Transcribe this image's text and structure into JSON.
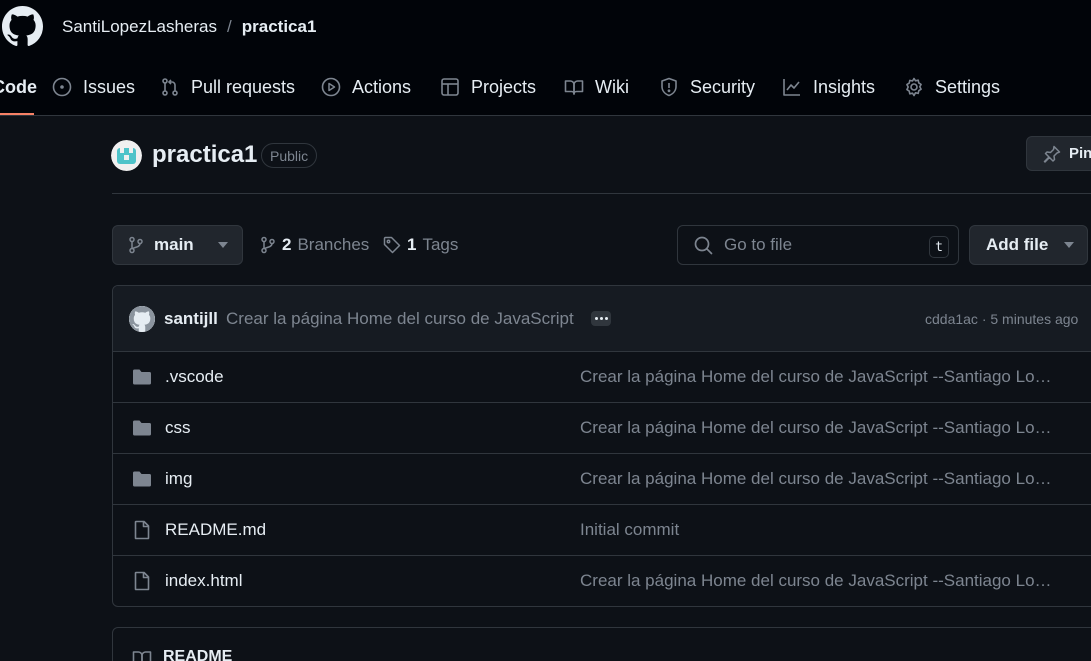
{
  "header": {
    "owner": "SantiLopezLasheras",
    "separator": "/",
    "repo": "practica1"
  },
  "tabs": [
    {
      "label": "Code",
      "icon": "code-icon"
    },
    {
      "label": "Issues",
      "icon": "issue-opened-icon"
    },
    {
      "label": "Pull requests",
      "icon": "git-pull-request-icon"
    },
    {
      "label": "Actions",
      "icon": "play-icon"
    },
    {
      "label": "Projects",
      "icon": "table-icon"
    },
    {
      "label": "Wiki",
      "icon": "book-icon"
    },
    {
      "label": "Security",
      "icon": "shield-icon"
    },
    {
      "label": "Insights",
      "icon": "graph-icon"
    },
    {
      "label": "Settings",
      "icon": "gear-icon"
    }
  ],
  "repo": {
    "name": "practica1",
    "visibility": "Public",
    "pin_label": "Pin"
  },
  "controls": {
    "branch": "main",
    "branches_count": "2",
    "branches_label": "Branches",
    "tags_count": "1",
    "tags_label": "Tags",
    "goto_placeholder": "Go to file",
    "goto_shortcut": "t",
    "add_file_label": "Add file"
  },
  "latest_commit": {
    "author": "santijll",
    "message": "Crear la página Home del curso de JavaScript",
    "meta": "cdda1ac · 5 minutes ago"
  },
  "files": [
    {
      "name": ".vscode",
      "type": "folder",
      "commit": "Crear la página Home del curso de JavaScript --Santiago Lopez Lasheras"
    },
    {
      "name": "css",
      "type": "folder",
      "commit": "Crear la página Home del curso de JavaScript --Santiago Lopez Lasheras"
    },
    {
      "name": "img",
      "type": "folder",
      "commit": "Crear la página Home del curso de JavaScript --Santiago Lopez Lasheras"
    },
    {
      "name": "README.md",
      "type": "file",
      "commit": "Initial commit"
    },
    {
      "name": "index.html",
      "type": "file",
      "commit": "Crear la página Home del curso de JavaScript --Santiago Lopez Lasheras"
    }
  ],
  "readme": {
    "label": "README"
  },
  "colors": {
    "background": "#0d1117",
    "header": "#010409",
    "border": "#30363d",
    "muted": "#7d8590",
    "accent": "#f78166"
  }
}
